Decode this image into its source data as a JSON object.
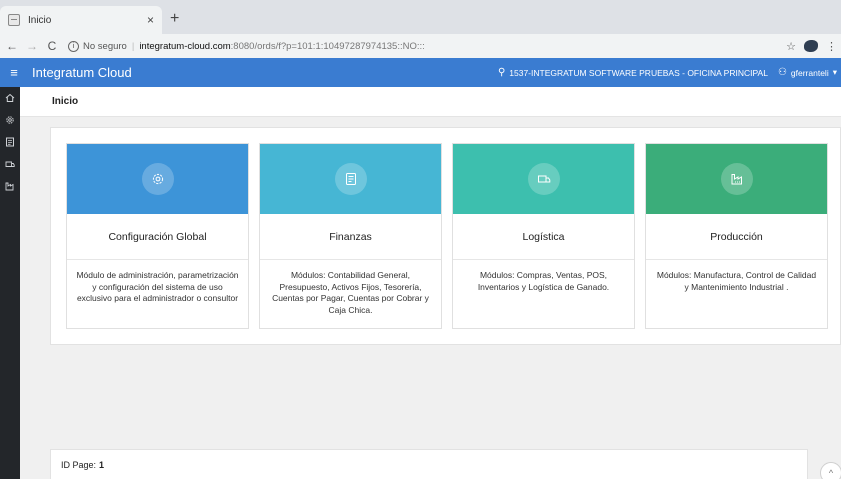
{
  "browser": {
    "tab_title": "Inicio",
    "tab_close": "×",
    "new_tab": "+",
    "back": "←",
    "forward": "→",
    "reload": "C",
    "security_label": "No seguro",
    "separator": "|",
    "url_host": "integratum-cloud.com",
    "url_path": ":8080/ords/f?p=101:1:10497287974135::NO:::",
    "bookmark": "☆",
    "menu": "⋮"
  },
  "header": {
    "menu_icon": "≡",
    "app_title": "Integratum Cloud",
    "org_icon": "⚲",
    "org": "1537-INTEGRATUM SOFTWARE PRUEBAS - OFICINA PRINCIPAL",
    "user_icon": "⚇",
    "user": "gferranteli",
    "user_caret": "▾"
  },
  "sidebar": {
    "items": [
      {
        "icon": "home-icon"
      },
      {
        "icon": "gear-icon"
      },
      {
        "icon": "ledger-icon"
      },
      {
        "icon": "truck-icon"
      },
      {
        "icon": "factory-icon"
      }
    ]
  },
  "breadcrumb": {
    "title": "Inicio"
  },
  "cards": [
    {
      "title": "Configuración Global",
      "description": "Módulo de administración, parametrización y configuración del sistema de uso exclusivo para el administrador o consultor",
      "color": "#3d94d8",
      "icon": "gear-icon"
    },
    {
      "title": "Finanzas",
      "description": "Módulos: Contabilidad General, Presupuesto, Activos Fijos, Tesorería, Cuentas por Pagar, Cuentas por Cobrar y Caja Chica.",
      "color": "#46b6d4",
      "icon": "ledger-icon"
    },
    {
      "title": "Logística",
      "description": "Módulos: Compras, Ventas, POS, Inventarios y Logística de Ganado.",
      "color": "#3dbfae",
      "icon": "truck-icon"
    },
    {
      "title": "Producción",
      "description": "Módulos: Manufactura, Control de Calidad y Mantenimiento Industrial .",
      "color": "#3bad7a",
      "icon": "factory-icon"
    }
  ],
  "footer": {
    "label": "ID Page:",
    "value": "1"
  },
  "scroll_top": "^"
}
